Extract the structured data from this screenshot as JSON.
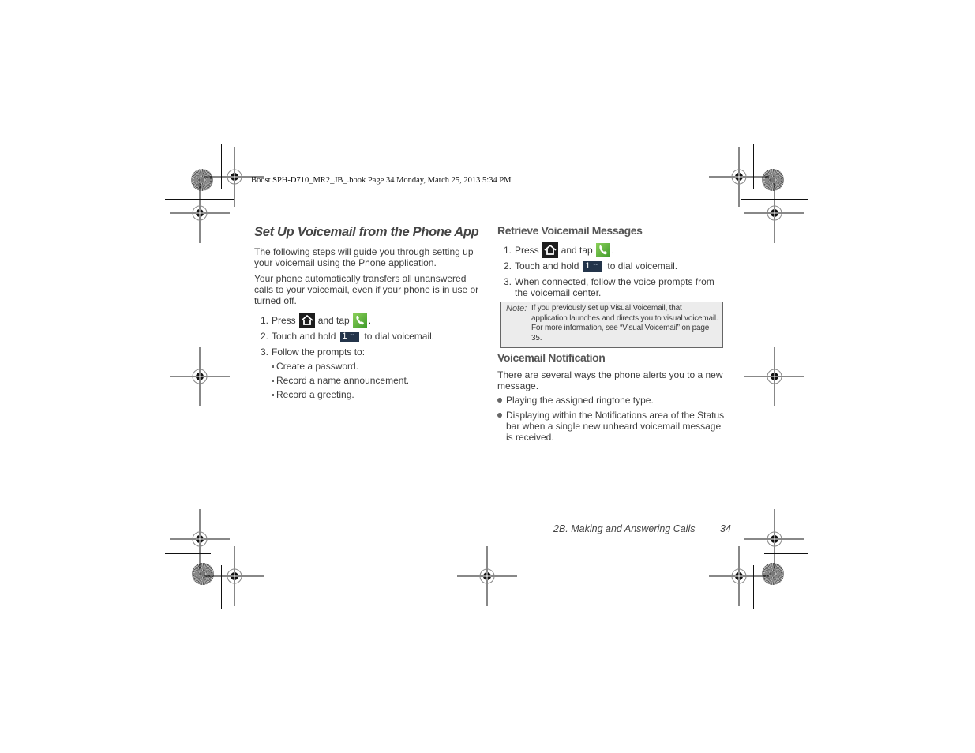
{
  "slug_line": "Boost SPH-D710_MR2_JB_.book  Page 34  Monday, March 25, 2013  5:34 PM",
  "left_column": {
    "heading": "Set Up Voicemail from the Phone App",
    "paragraphs": [
      "The following steps will guide you through setting up your voicemail using the Phone application.",
      "Your phone automatically transfers all unanswered calls to your voicemail, even if your phone is in use or turned off."
    ],
    "steps": [
      {
        "num": "1.",
        "before": "Press",
        "middle": "and tap",
        "after": "."
      },
      {
        "num": "2.",
        "before": "Touch and hold",
        "after": "to dial voicemail."
      },
      {
        "num": "3.",
        "text": "Follow the prompts to:"
      }
    ],
    "sub_bullets": [
      "Create a password.",
      "Record a name announcement.",
      "Record a greeting."
    ]
  },
  "right_column": {
    "retrieve_heading": "Retrieve Voicemail Messages",
    "steps": [
      {
        "num": "1.",
        "before": "Press",
        "middle": "and tap",
        "after": "."
      },
      {
        "num": "2.",
        "before": "Touch and hold",
        "after": "to dial voicemail."
      },
      {
        "num": "3.",
        "text": "When connected, follow the voice prompts from the voicemail center."
      }
    ],
    "note": {
      "label": "Note:",
      "text": "If you previously set up Visual Voicemail, that application launches and directs you to visual voicemail. For more information, see “Visual Voicemail” on page 35."
    },
    "notification_heading": "Voicemail Notification",
    "notification_intro": "There are several ways the phone alerts you to a new message.",
    "notification_bullets": [
      "Playing the assigned ringtone type.",
      "Displaying within the Notifications area of the Status bar when a single new unheard voicemail message is received."
    ]
  },
  "footer": {
    "section": "2B. Making and Answering Calls",
    "page_number": "34"
  },
  "icons": {
    "home_key": "home-key-icon",
    "phone_app": "phone-app-icon",
    "voicemail_key": "voicemail-key-icon",
    "voicemail_key_digit": "1",
    "voicemail_key_glyph": "°°"
  }
}
